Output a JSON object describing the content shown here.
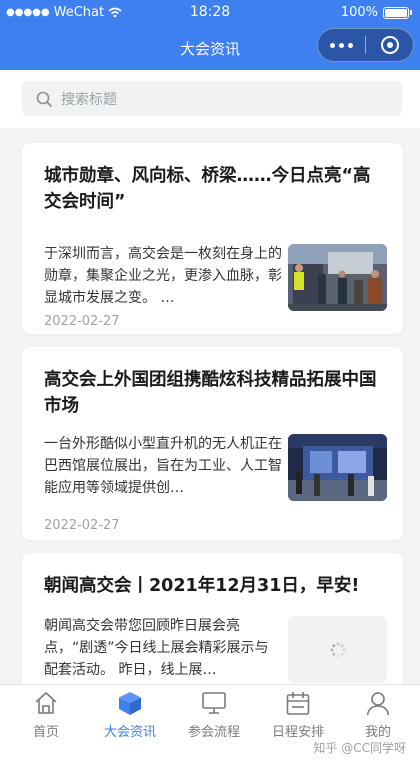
{
  "status_bar": {
    "carrier": "WeChat",
    "time": "18:28",
    "battery": "100%"
  },
  "header": {
    "title": "大会资讯"
  },
  "search": {
    "placeholder": "搜索标题"
  },
  "articles": [
    {
      "title": "城市勋章、风向标、桥梁……今日点亮“高交会时间”",
      "summary": "于深圳而言，高交会是一枚刻在身上的勋章，集聚企业之光，更渗入血脉，彰显城市发展之变。 …",
      "date": "2022-02-27"
    },
    {
      "title": "高交会上外国团组携酷炫科技精品拓展中国市场",
      "summary": "一台外形酷似小型直升机的无人机正在巴西馆展位展出，旨在为工业、人工智能应用等领域提供创…",
      "date": "2022-02-27"
    },
    {
      "title": "朝闻高交会丨2021年12月31日，早安!",
      "summary": "朝闻高交会带您回顾昨日展会亮点，“剧透”今日线上展会精彩展示与配套活动。 昨日，线上展…",
      "date": ""
    }
  ],
  "tabbar": {
    "items": [
      {
        "label": "首页",
        "icon": "home-icon",
        "active": false
      },
      {
        "label": "大会资讯",
        "icon": "cube-icon",
        "active": true
      },
      {
        "label": "参会流程",
        "icon": "monitor-icon",
        "active": false
      },
      {
        "label": "日程安排",
        "icon": "calendar-icon",
        "active": false
      },
      {
        "label": "我的",
        "icon": "user-icon",
        "active": false
      }
    ]
  },
  "watermark": "知乎 @CC同学呀",
  "colors": {
    "primary": "#3e80ef",
    "capsule": "#2b56a8",
    "background": "#f3f4f6"
  }
}
